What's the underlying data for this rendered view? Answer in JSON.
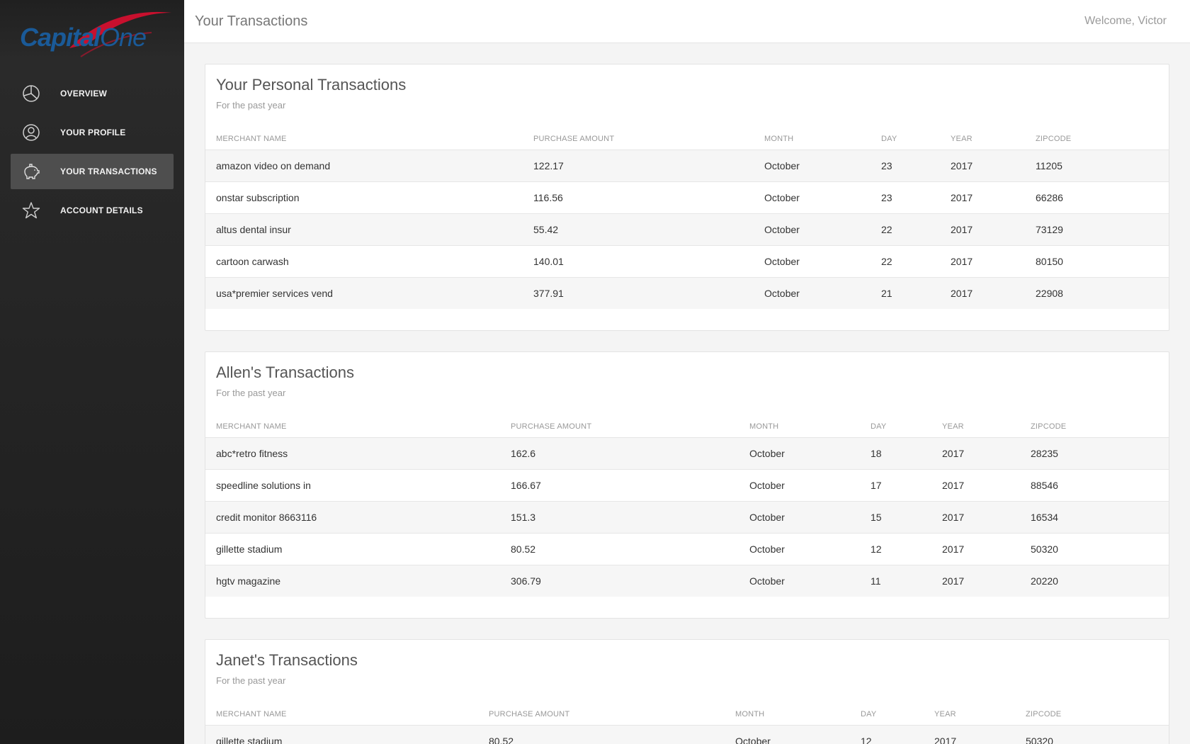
{
  "brand": {
    "logo_text_1": "Capital",
    "logo_text_2": "One",
    "brand_blue": "#1a5a98",
    "swoosh_red": "#c8102e"
  },
  "sidebar": {
    "items": [
      {
        "label": "OVERVIEW",
        "icon": "pie-chart-icon",
        "active": false
      },
      {
        "label": "YOUR PROFILE",
        "icon": "user-icon",
        "active": false
      },
      {
        "label": "YOUR TRANSACTIONS",
        "icon": "piggy-bank-icon",
        "active": true
      },
      {
        "label": "ACCOUNT DETAILS",
        "icon": "star-icon",
        "active": false
      }
    ]
  },
  "header": {
    "title": "Your Transactions",
    "welcome": "Welcome, Victor"
  },
  "columns": [
    "MERCHANT NAME",
    "PURCHASE AMOUNT",
    "MONTH",
    "DAY",
    "YEAR",
    "ZIPCODE"
  ],
  "cards": [
    {
      "title": "Your Personal Transactions",
      "subtitle": "For the past year",
      "rows": [
        [
          "amazon video on demand",
          "122.17",
          "October",
          "23",
          "2017",
          "11205"
        ],
        [
          "onstar subscription",
          "116.56",
          "October",
          "23",
          "2017",
          "66286"
        ],
        [
          "altus dental insur",
          "55.42",
          "October",
          "22",
          "2017",
          "73129"
        ],
        [
          "cartoon carwash",
          "140.01",
          "October",
          "22",
          "2017",
          "80150"
        ],
        [
          "usa*premier services vend",
          "377.91",
          "October",
          "21",
          "2017",
          "22908"
        ]
      ]
    },
    {
      "title": "Allen's Transactions",
      "subtitle": "For the past year",
      "rows": [
        [
          "abc*retro fitness",
          "162.6",
          "October",
          "18",
          "2017",
          "28235"
        ],
        [
          "speedline solutions in",
          "166.67",
          "October",
          "17",
          "2017",
          "88546"
        ],
        [
          "credit monitor 8663116",
          "151.3",
          "October",
          "15",
          "2017",
          "16534"
        ],
        [
          "gillette stadium",
          "80.52",
          "October",
          "12",
          "2017",
          "50320"
        ],
        [
          "hgtv magazine",
          "306.79",
          "October",
          "11",
          "2017",
          "20220"
        ]
      ]
    },
    {
      "title": "Janet's Transactions",
      "subtitle": "For the past year",
      "rows": [
        [
          "gillette stadium",
          "80.52",
          "October",
          "12",
          "2017",
          "50320"
        ]
      ]
    }
  ]
}
